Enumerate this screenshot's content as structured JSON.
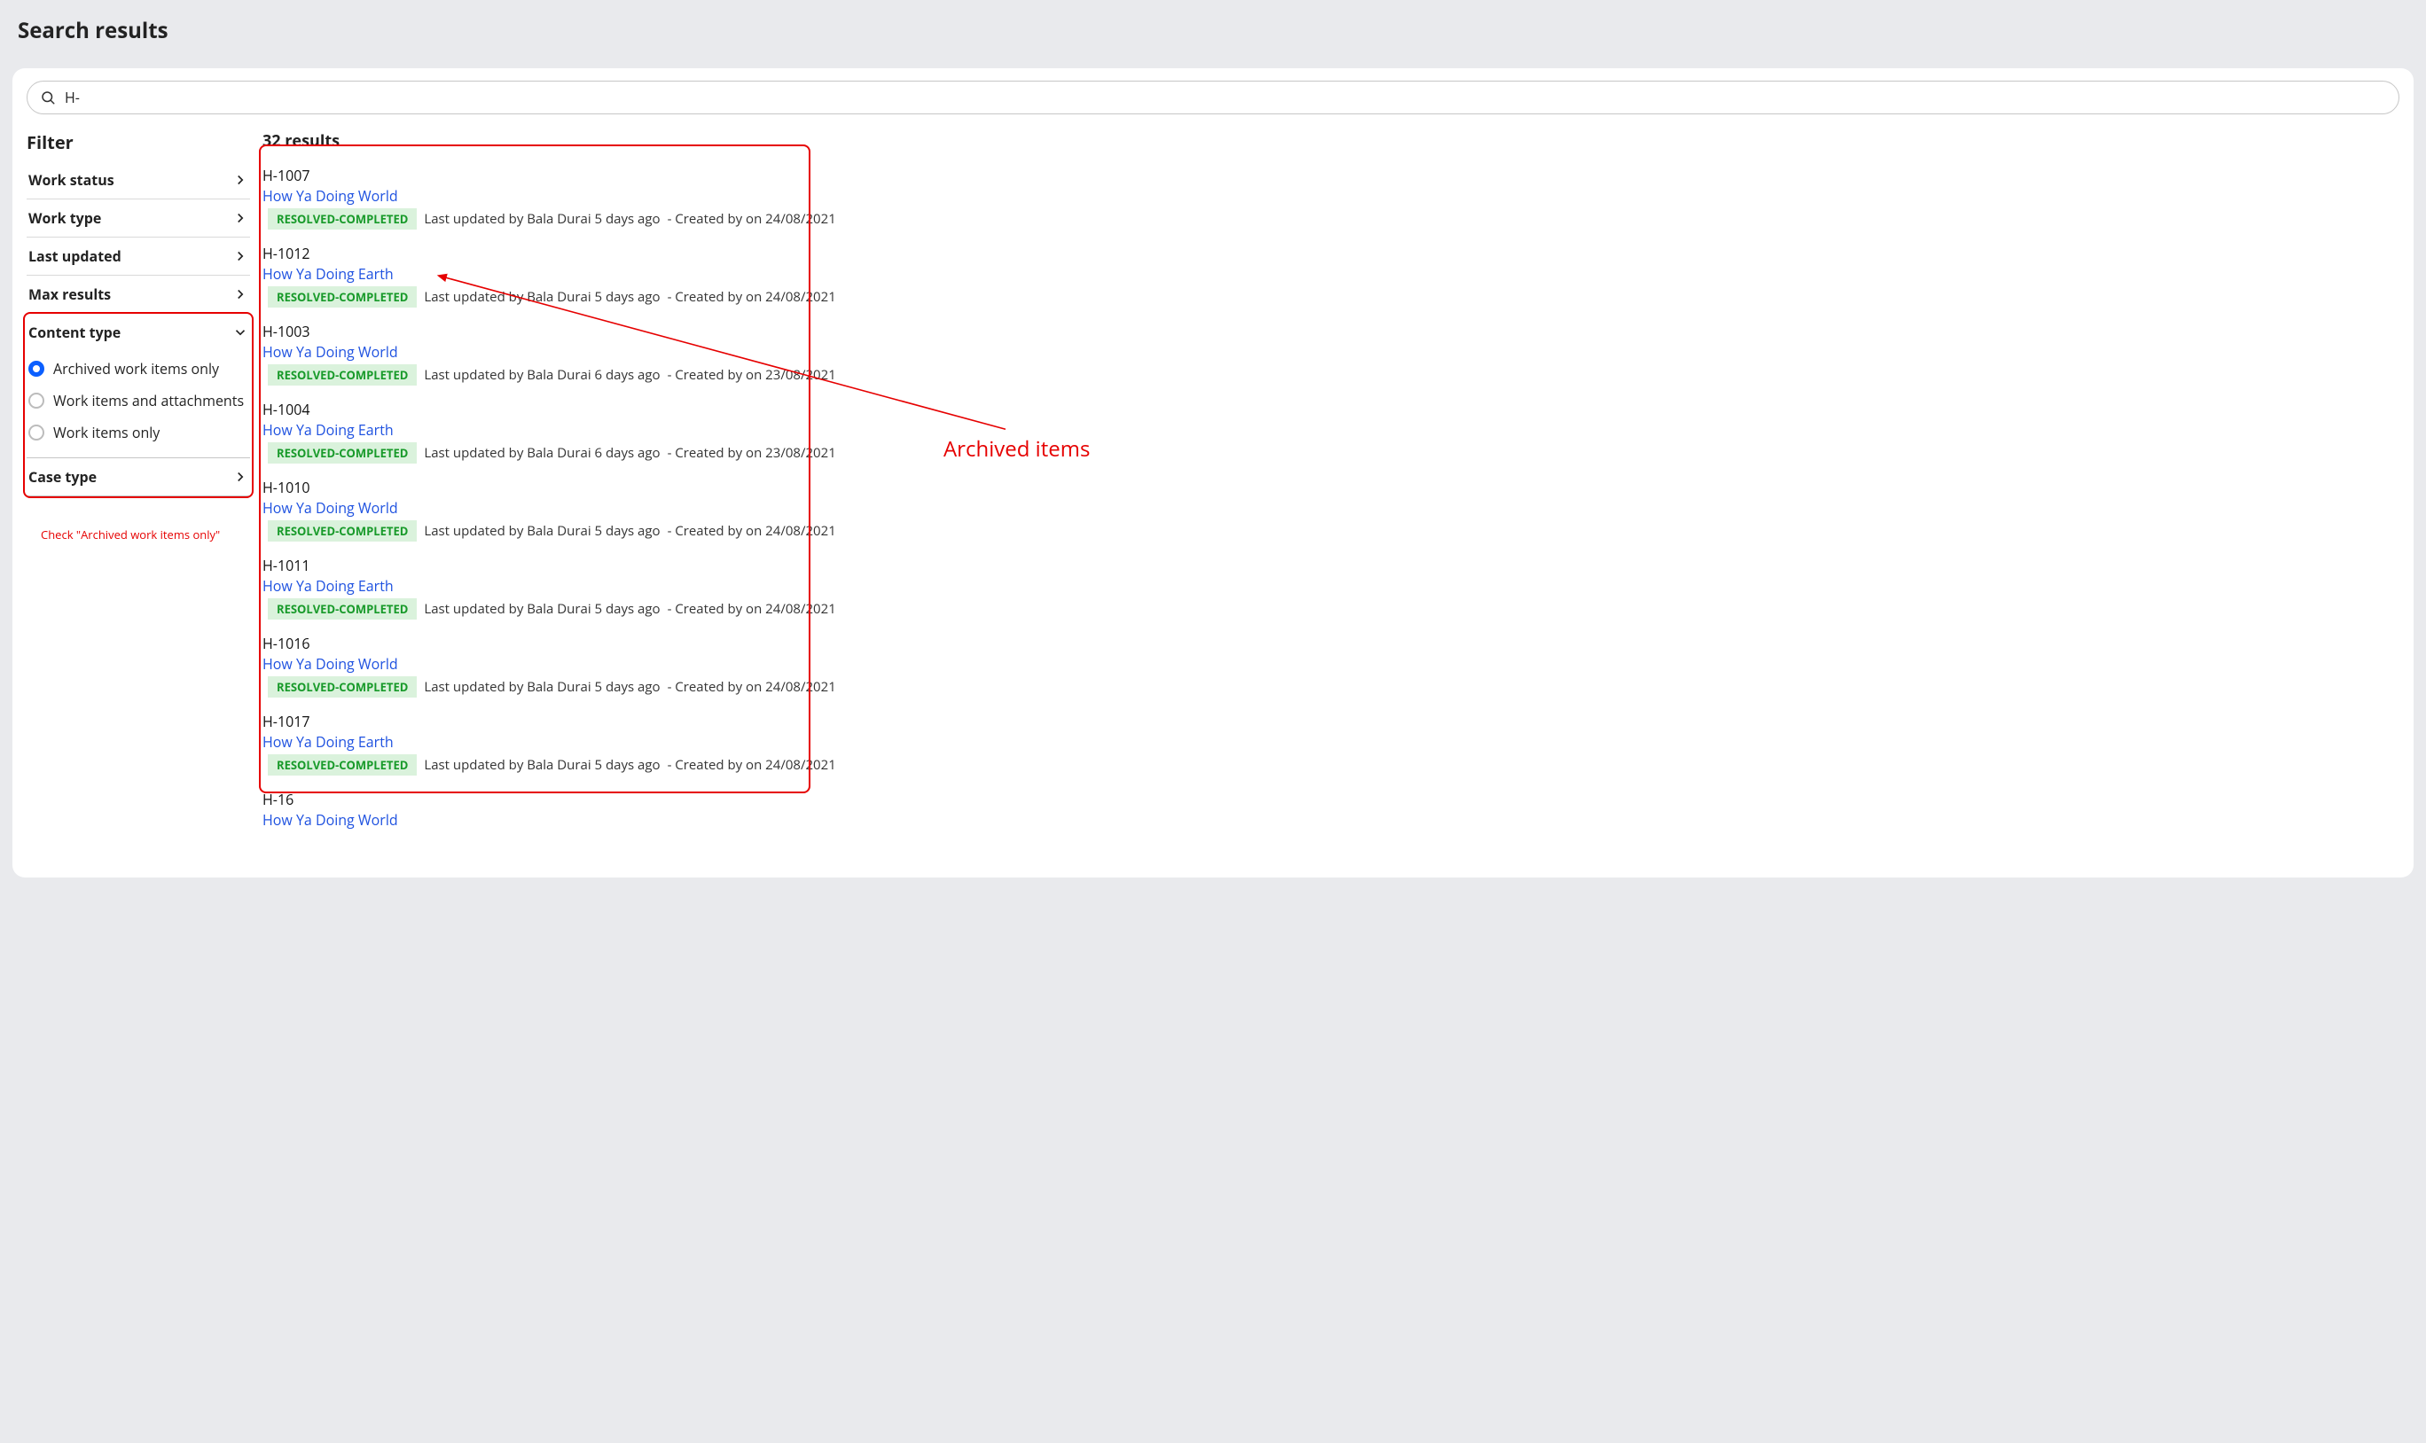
{
  "page_title": "Search results",
  "search": {
    "value": "H-",
    "placeholder": ""
  },
  "sidebar": {
    "heading": "Filter",
    "sections": {
      "work_status": {
        "label": "Work status"
      },
      "work_type": {
        "label": "Work type"
      },
      "last_updated": {
        "label": "Last updated"
      },
      "max_results": {
        "label": "Max results"
      },
      "content_type": {
        "label": "Content type",
        "options": [
          {
            "label": "Archived work items only",
            "selected": true
          },
          {
            "label": "Work items and attachments",
            "selected": false
          },
          {
            "label": "Work items only",
            "selected": false
          }
        ]
      },
      "case_type": {
        "label": "Case type"
      }
    }
  },
  "main": {
    "count_label": "32 results",
    "status_label": "RESOLVED-COMPLETED",
    "updated_prefix": "Last updated by",
    "ago_word": "ago",
    "created_prefix": "- Created by",
    "on_word": "on",
    "items": [
      {
        "id": "H-1007",
        "title": "How Ya Doing World",
        "updater": "Bala Durai",
        "ago": "5 days",
        "creator": "",
        "date": "24/08/2021"
      },
      {
        "id": "H-1012",
        "title": "How Ya Doing Earth",
        "updater": "Bala Durai",
        "ago": "5 days",
        "creator": "",
        "date": "24/08/2021"
      },
      {
        "id": "H-1003",
        "title": "How Ya Doing World",
        "updater": "Bala Durai",
        "ago": "6 days",
        "creator": "",
        "date": "23/08/2021"
      },
      {
        "id": "H-1004",
        "title": "How Ya Doing Earth",
        "updater": "Bala Durai",
        "ago": "6 days",
        "creator": "",
        "date": "23/08/2021"
      },
      {
        "id": "H-1010",
        "title": "How Ya Doing World",
        "updater": "Bala Durai",
        "ago": "5 days",
        "creator": "",
        "date": "24/08/2021"
      },
      {
        "id": "H-1011",
        "title": "How Ya Doing Earth",
        "updater": "Bala Durai",
        "ago": "5 days",
        "creator": "",
        "date": "24/08/2021"
      },
      {
        "id": "H-1016",
        "title": "How Ya Doing World",
        "updater": "Bala Durai",
        "ago": "5 days",
        "creator": "",
        "date": "24/08/2021"
      },
      {
        "id": "H-1017",
        "title": "How Ya Doing Earth",
        "updater": "Bala Durai",
        "ago": "5 days",
        "creator": "",
        "date": "24/08/2021"
      },
      {
        "id": "H-16",
        "title": "How Ya Doing World",
        "updater": "",
        "ago": "",
        "creator": "",
        "date": ""
      }
    ]
  },
  "annotations": {
    "filter_callout": "Check  \"Archived work items only\"",
    "archived_label": "Archived items",
    "show_last_meta": false
  }
}
